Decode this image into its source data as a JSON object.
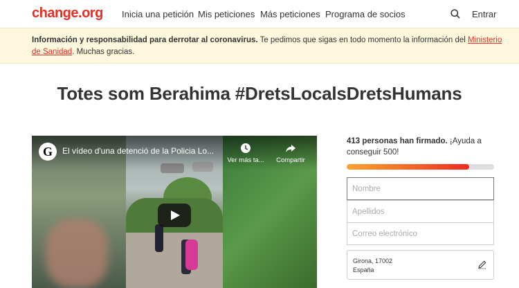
{
  "header": {
    "logo": "change.org",
    "nav": [
      "Inicia una petición",
      "Mis peticiones",
      "Más peticiones",
      "Programa de socios"
    ],
    "login": "Entrar",
    "search_icon": "search-icon"
  },
  "banner": {
    "bold": "Información y responsabilidad para derrotar al coronavirus.",
    "text": " Te pedimos que sigas en todo momento la información del ",
    "link": "Ministerio de Sanidad",
    "end": ". Muchas gracias."
  },
  "petition": {
    "title": "Totes som Berahima #DretsLocalsDretsHumans"
  },
  "video": {
    "channel_letter": "G",
    "title": "El vídeo d'una detenció de la Policia Lo...",
    "watch_later": "Ver más ta...",
    "share": "Compartir"
  },
  "sign": {
    "count_bold": "413 personas han firmado.",
    "count_rest": " ¡Ayuda a conseguir 500!",
    "progress": 0.83,
    "fields": {
      "first_name": "Nombre",
      "last_name": "Apellidos",
      "email": "Correo electrónico"
    },
    "location": {
      "line1": "Girona, 17002",
      "line2": "España"
    }
  },
  "colors": {
    "brand": "#ec2c22",
    "banner_bg": "#fdf7dd",
    "progress_start": "#f9a532",
    "progress_end": "#ec2c22"
  }
}
